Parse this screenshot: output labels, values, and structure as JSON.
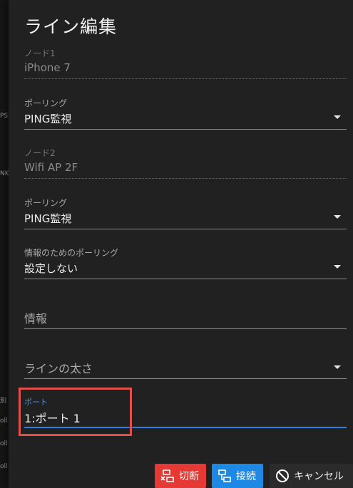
{
  "dialog": {
    "title": "ライン編集",
    "node1": {
      "label": "ノード1",
      "value": "iPhone 7"
    },
    "polling1": {
      "label": "ポーリング",
      "value": "PING監視"
    },
    "node2": {
      "label": "ノード2",
      "value": "Wifi AP 2F"
    },
    "polling2": {
      "label": "ポーリング",
      "value": "PING監視"
    },
    "info_polling": {
      "label": "情報のためのポーリング",
      "value": "設定しない"
    },
    "info": {
      "placeholder": "情報"
    },
    "line_width": {
      "placeholder": "ラインの太さ"
    },
    "port": {
      "label": "ポート",
      "value": "1:ポート 1"
    }
  },
  "buttons": {
    "disconnect": "切断",
    "connect": "接続",
    "cancel": "キャンセル"
  },
  "background": {
    "fragments": [
      "PS",
      "NK",
      "別",
      "oll",
      "oll",
      "oll"
    ]
  },
  "colors": {
    "disconnect": "#e53935",
    "connect": "#1e88e5",
    "focus": "#2f7de1",
    "highlight": "#e2504c"
  }
}
